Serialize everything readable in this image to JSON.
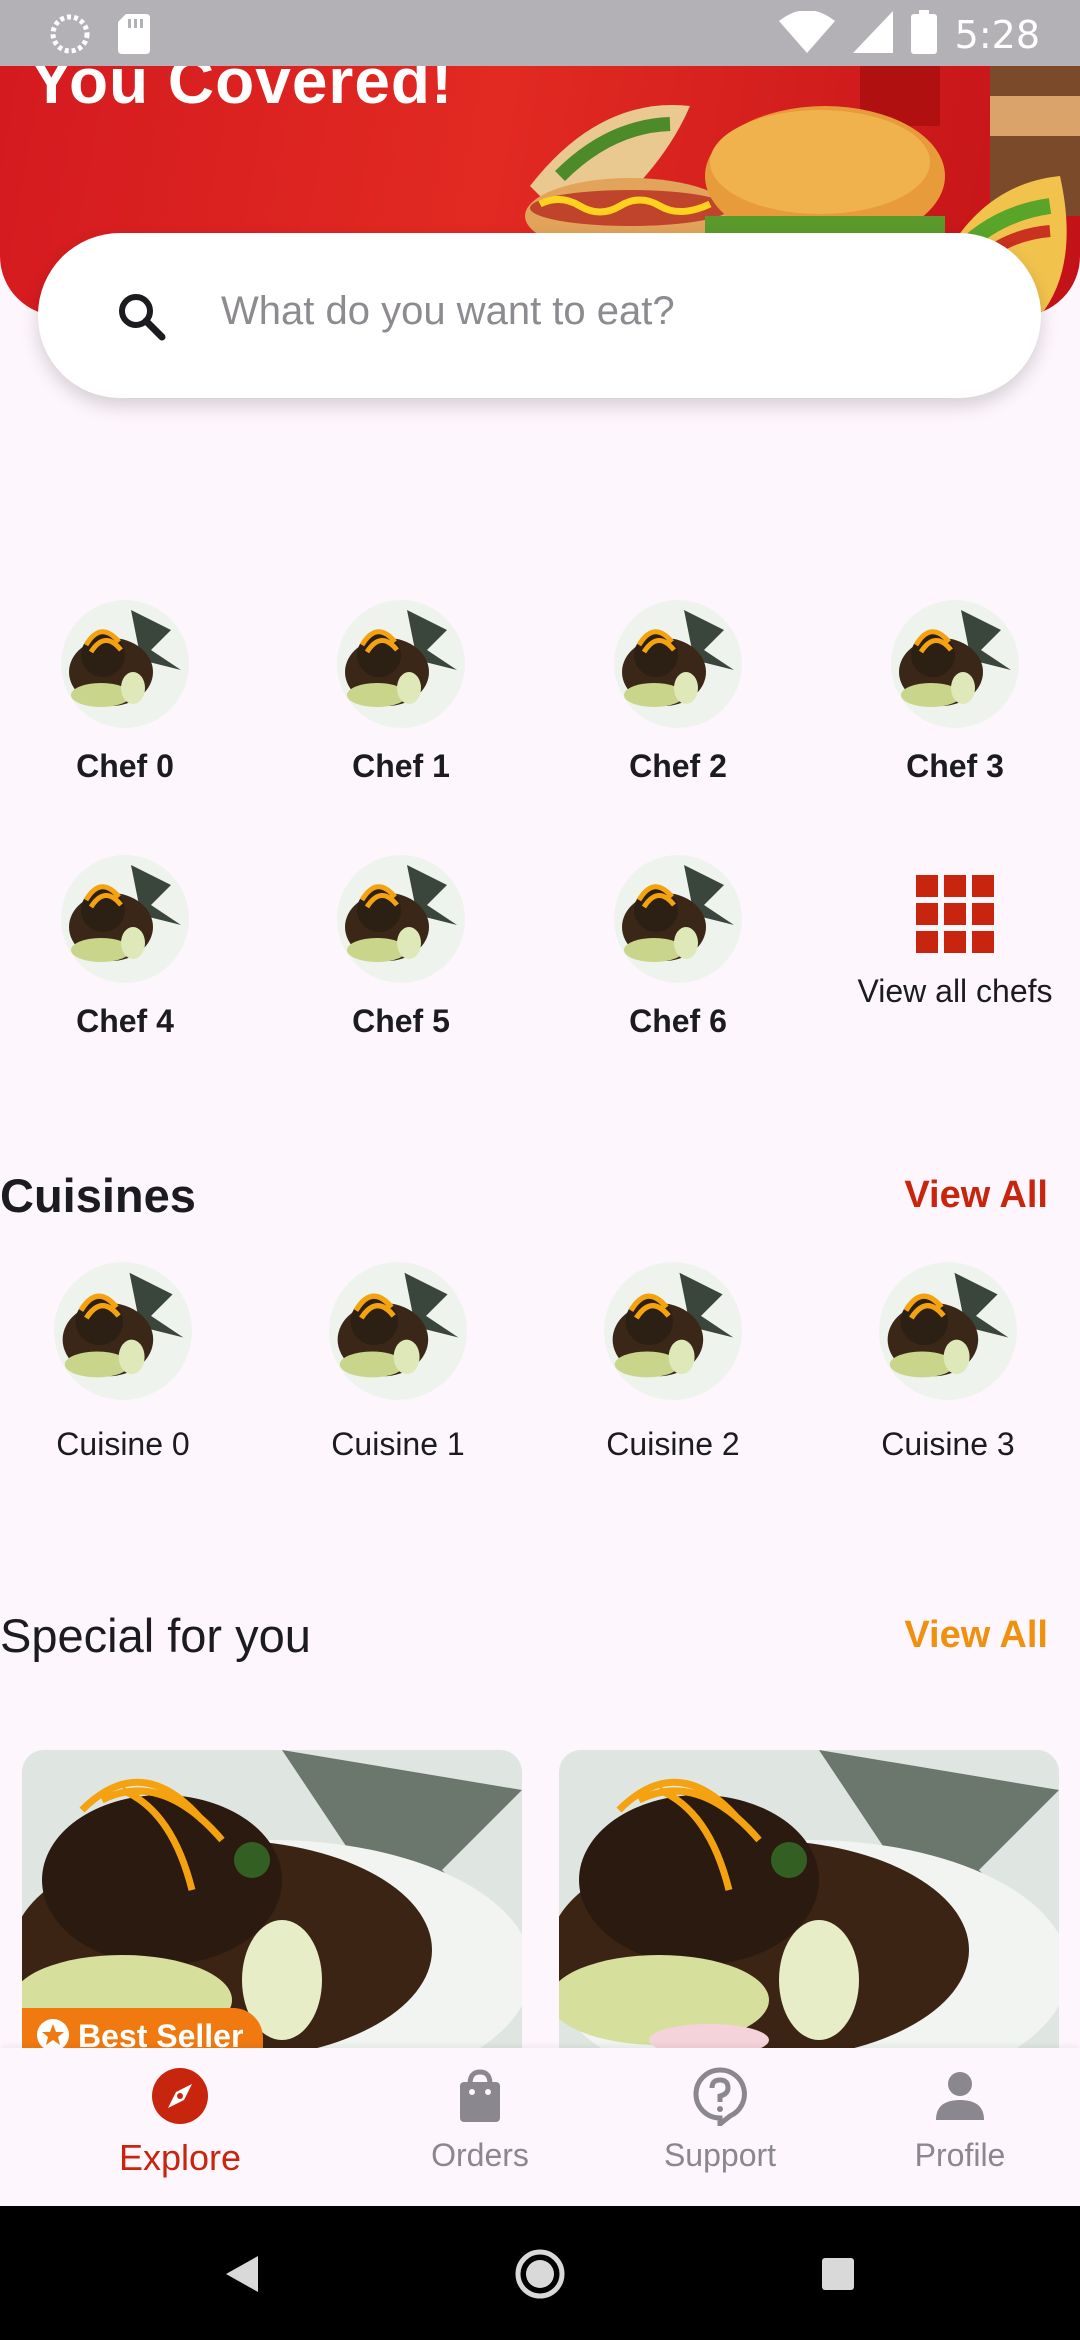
{
  "status_bar": {
    "time": "5:28"
  },
  "hero": {
    "title": "You Covered!"
  },
  "search": {
    "placeholder": "What do you want to eat?"
  },
  "chefs": [
    {
      "name": "Chef 0"
    },
    {
      "name": "Chef 1"
    },
    {
      "name": "Chef 2"
    },
    {
      "name": "Chef 3"
    },
    {
      "name": "Chef 4"
    },
    {
      "name": "Chef 5"
    },
    {
      "name": "Chef 6"
    }
  ],
  "view_all_chefs": {
    "label": "View all chefs",
    "icon": "grid-icon"
  },
  "cuisines_section": {
    "title": "Cuisines",
    "view_all": "View All",
    "link_color": "#c8250e"
  },
  "cuisines": [
    {
      "name": "Cuisine 0"
    },
    {
      "name": "Cuisine 1"
    },
    {
      "name": "Cuisine 2"
    },
    {
      "name": "Cuisine 3"
    }
  ],
  "special_section": {
    "title": "Special for you",
    "view_all": "View All",
    "link_color": "#f0900f"
  },
  "special_cards": [
    {
      "badge": "Best Seller"
    },
    {
      "badge": ""
    }
  ],
  "bottom_nav": {
    "items": [
      {
        "label": "Explore",
        "icon": "compass-icon",
        "active": true
      },
      {
        "label": "Orders",
        "icon": "shopping-bag-icon",
        "active": false
      },
      {
        "label": "Support",
        "icon": "help-icon",
        "active": false
      },
      {
        "label": "Profile",
        "icon": "person-icon",
        "active": false
      }
    ]
  },
  "colors": {
    "accent": "#c8250e",
    "orange": "#f0900f",
    "hero_red": "#d41a1f",
    "background": "#fdf6fc"
  }
}
